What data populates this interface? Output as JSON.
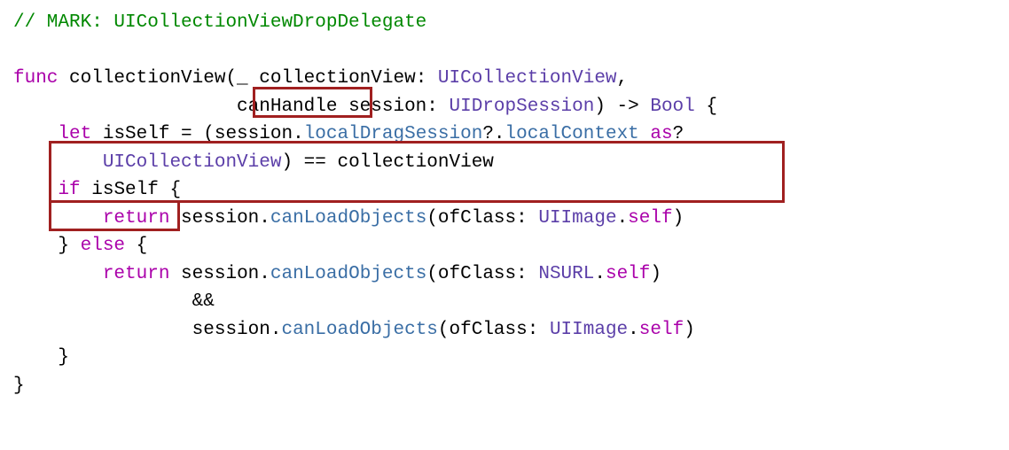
{
  "line1_comment": "// MARK: UICollectionViewDropDelegate",
  "l3_func": "func",
  "l3_fname": " collectionView(_ collectionView: ",
  "l3_type1": "UICollectionView",
  "l3_comma": ",",
  "l4_pad": "                    ",
  "l4_canhandle": "canHandle",
  "l4_session": " session: ",
  "l4_type": "UIDropSession",
  "l4_arrow": ") -> ",
  "l4_bool": "Bool",
  "l4_brace": " {",
  "l5_pad": "    ",
  "l5_let": "let",
  "l5_isself": " isSelf = (session.",
  "l5_local": "localDragSession",
  "l5_q": "?.",
  "l5_ctx": "localContext",
  "l5_as": " as",
  "l5_qmark": "?",
  "l6_pad": "        ",
  "l6_type": "UICollectionView",
  "l6_eq": ") == collectionView",
  "l7_pad": "    ",
  "l7_if": "if",
  "l7_isself": " isSelf",
  "l7_brace": " {",
  "l8_pad": "        ",
  "l8_return": "return",
  "l8_sess": " session.",
  "l8_can": "canLoadObjects",
  "l8_of": "(ofClass: ",
  "l8_uiimage": "UIImage",
  "l8_dot": ".",
  "l8_self": "self",
  "l8_close": ")",
  "l9_pad": "    } ",
  "l9_else": "else",
  "l9_brace": " {",
  "l10_pad": "        ",
  "l10_return": "return",
  "l10_sess": " session.",
  "l10_can": "canLoadObjects",
  "l10_of": "(ofClass: ",
  "l10_nsurl": "NSURL",
  "l10_dot": ".",
  "l10_self": "self",
  "l10_close": ")",
  "l11_pad": "                ",
  "l11_amp": "&&",
  "l12_pad": "                ",
  "l12_sess": "session.",
  "l12_can": "canLoadObjects",
  "l12_of": "(ofClass: ",
  "l12_uiimage": "UIImage",
  "l12_dot": ".",
  "l12_self": "self",
  "l12_close": ")",
  "l13_pad": "    }",
  "l14_close": "}"
}
